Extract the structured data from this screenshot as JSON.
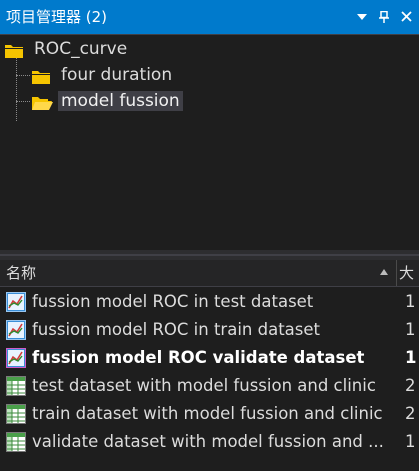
{
  "window": {
    "title": "项目管理器 (2)",
    "buttons": {
      "dropdown_icon": "dropdown-arrow-icon",
      "pin_icon": "pin-icon",
      "close_icon": "close-icon"
    }
  },
  "tree": {
    "root": {
      "label": "ROC_curve",
      "icon": "folder-icon"
    },
    "children": [
      {
        "label": "four duration",
        "icon": "folder-icon",
        "selected": false
      },
      {
        "label": "model fussion",
        "icon": "folder-open-icon",
        "selected": true
      }
    ]
  },
  "list": {
    "columns": {
      "name": "名称",
      "size": "大"
    },
    "sort_icon": "sort-ascending-icon",
    "rows": [
      {
        "name": "fussion model ROC in test dataset",
        "size": "1",
        "icon": "graph-icon",
        "bold": false
      },
      {
        "name": "fussion model ROC in train dataset",
        "size": "1",
        "icon": "graph-icon",
        "bold": false
      },
      {
        "name": "fussion model ROC validate dataset",
        "size": "1",
        "icon": "graph-icon",
        "bold": true
      },
      {
        "name": "test dataset with model fussion and clinic",
        "size": "2",
        "icon": "worksheet-icon",
        "bold": false
      },
      {
        "name": "train dataset with model fussion and clinic",
        "size": "2",
        "icon": "worksheet-icon",
        "bold": false
      },
      {
        "name": "validate dataset with model fussion and ...",
        "size": "1",
        "icon": "worksheet-icon",
        "bold": false
      }
    ]
  },
  "colors": {
    "title_bar": "#007acc",
    "panel_bg": "#1e1e1e",
    "folder": "#f5c400",
    "selected_bg": "#3f3f46"
  }
}
